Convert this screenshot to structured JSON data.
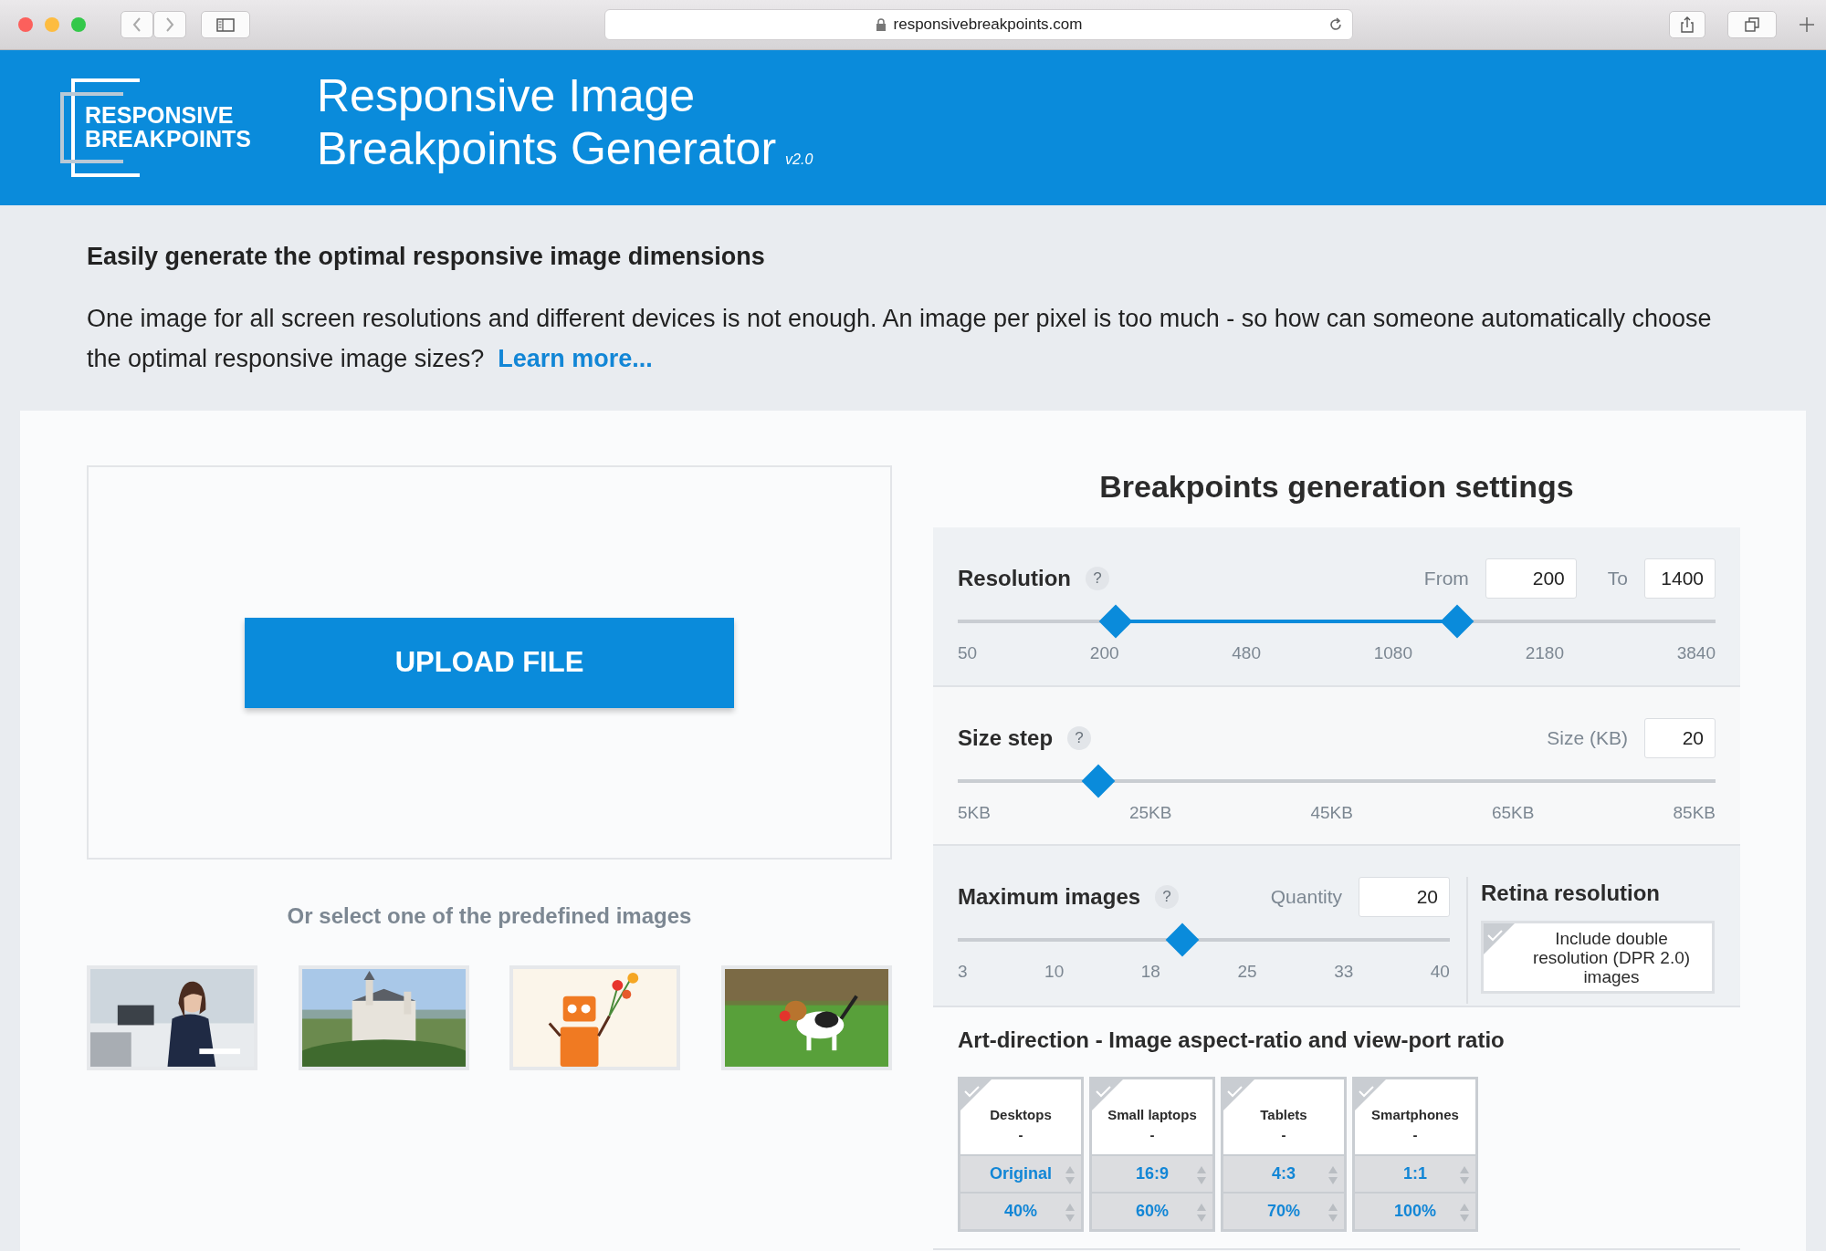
{
  "browser": {
    "url": "responsivebreakpoints.com"
  },
  "header": {
    "logo_lines": [
      "RESPONSIVE",
      "BREAKPOINTS"
    ],
    "title_lines": [
      "Responsive Image",
      "Breakpoints Generator"
    ],
    "version": "v2.0"
  },
  "intro": {
    "heading": "Easily generate the optimal responsive image dimensions",
    "text": "One image for all screen resolutions and different devices is not enough. An image per pixel is too much - so how can someone automatically choose the optimal responsive image sizes?",
    "link": "Learn more..."
  },
  "upload": {
    "button": "UPLOAD FILE",
    "caption": "Or select one of the predefined images"
  },
  "settings": {
    "title": "Breakpoints generation settings",
    "resolution": {
      "label": "Resolution",
      "help": "?",
      "from_label": "From",
      "from_value": "200",
      "to_label": "To",
      "to_value": "1400",
      "thumbs": [
        {
          "level": 0.209
        },
        {
          "level": 0.659
        }
      ],
      "ticks": [
        "50",
        "200",
        "480",
        "1080",
        "2180",
        "3840"
      ]
    },
    "size_step": {
      "label": "Size step",
      "help": "?",
      "field_label": "Size (KB)",
      "value": "20",
      "level": 0.186,
      "ticks": [
        "5KB",
        "25KB",
        "45KB",
        "65KB",
        "85KB"
      ]
    },
    "max_images": {
      "label": "Maximum images",
      "help": "?",
      "field_label": "Quantity",
      "value": "20",
      "level": 0.456,
      "ticks": [
        "3",
        "10",
        "18",
        "25",
        "33",
        "40"
      ]
    },
    "retina": {
      "title": "Retina resolution",
      "option": "Include double resolution (DPR 2.0) images",
      "checked": false
    }
  },
  "art_direction": {
    "title": "Art-direction - Image aspect-ratio and view-port ratio",
    "devices": [
      {
        "name": "Desktops",
        "sub": "-",
        "ratio": "Original",
        "percent": "40%",
        "checked": false
      },
      {
        "name": "Small laptops",
        "sub": "-",
        "ratio": "16:9",
        "percent": "60%",
        "checked": false
      },
      {
        "name": "Tablets",
        "sub": "-",
        "ratio": "4:3",
        "percent": "70%",
        "checked": false
      },
      {
        "name": "Smartphones",
        "sub": "-",
        "ratio": "1:1",
        "percent": "100%",
        "checked": false
      }
    ]
  }
}
